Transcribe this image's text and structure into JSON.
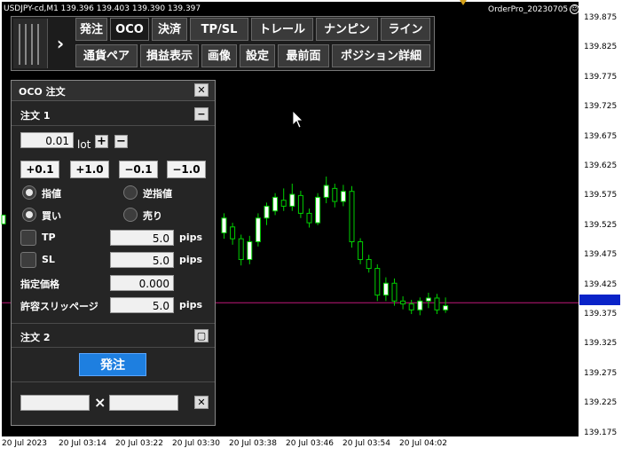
{
  "chart": {
    "symbol_info": "USDJPY-cd,M1  139.396 139.403 139.390 139.397",
    "brand": "OrderPro_20230705",
    "price_ticks": [
      "139.875",
      "139.825",
      "139.775",
      "139.725",
      "139.675",
      "139.625",
      "139.575",
      "139.525",
      "139.475",
      "139.425",
      "139.375",
      "139.325",
      "139.275",
      "139.225",
      "139.175"
    ],
    "time_ticks": [
      "20 Jul 2023",
      "20 Jul 03:14",
      "20 Jul 03:22",
      "20 Jul 03:30",
      "20 Jul 03:38",
      "20 Jul 03:46",
      "20 Jul 03:54",
      "20 Jul 04:02"
    ],
    "current_price": 139.397,
    "colors": {
      "background": "#000000",
      "candle_up": "#ffffff",
      "candle_outline": "#00d000",
      "price_line": "#c0187a",
      "price_box": "#0a23c8"
    }
  },
  "toolbar": {
    "row1": [
      "発注",
      "OCO",
      "決済",
      "TP/SL",
      "トレール",
      "ナンピン",
      "ライン"
    ],
    "row2": [
      "通貨ペア",
      "損益表示",
      "画像",
      "設定",
      "最前面",
      "ポジション詳細"
    ],
    "expand_icon": "chevron-right-icon",
    "grip_icon": "grip-icon"
  },
  "panel": {
    "title": "OCO 注文",
    "close_icon": "close-icon",
    "order1": {
      "label": "注文 1",
      "collapse_icon": "minimize-icon",
      "lot_value": "0.01",
      "lot_unit": "lot",
      "plus": "+",
      "minus": "−",
      "steps": [
        "+0.1",
        "+1.0",
        "−0.1",
        "−1.0"
      ],
      "limit": "指値",
      "stop": "逆指値",
      "buy": "買い",
      "sell": "売り",
      "tp_label": "TP",
      "tp_value": "5.0",
      "sl_label": "SL",
      "sl_value": "5.0",
      "pips": "pips",
      "price_label": "指定価格",
      "price_value": "0.000",
      "slip_label": "許容スリッページ",
      "slip_value": "5.0"
    },
    "order2": {
      "label": "注文 2",
      "expand_icon": "maximize-icon"
    },
    "send_label": "発注",
    "bottom": {
      "x": "×",
      "close_icon": "close-icon"
    }
  }
}
